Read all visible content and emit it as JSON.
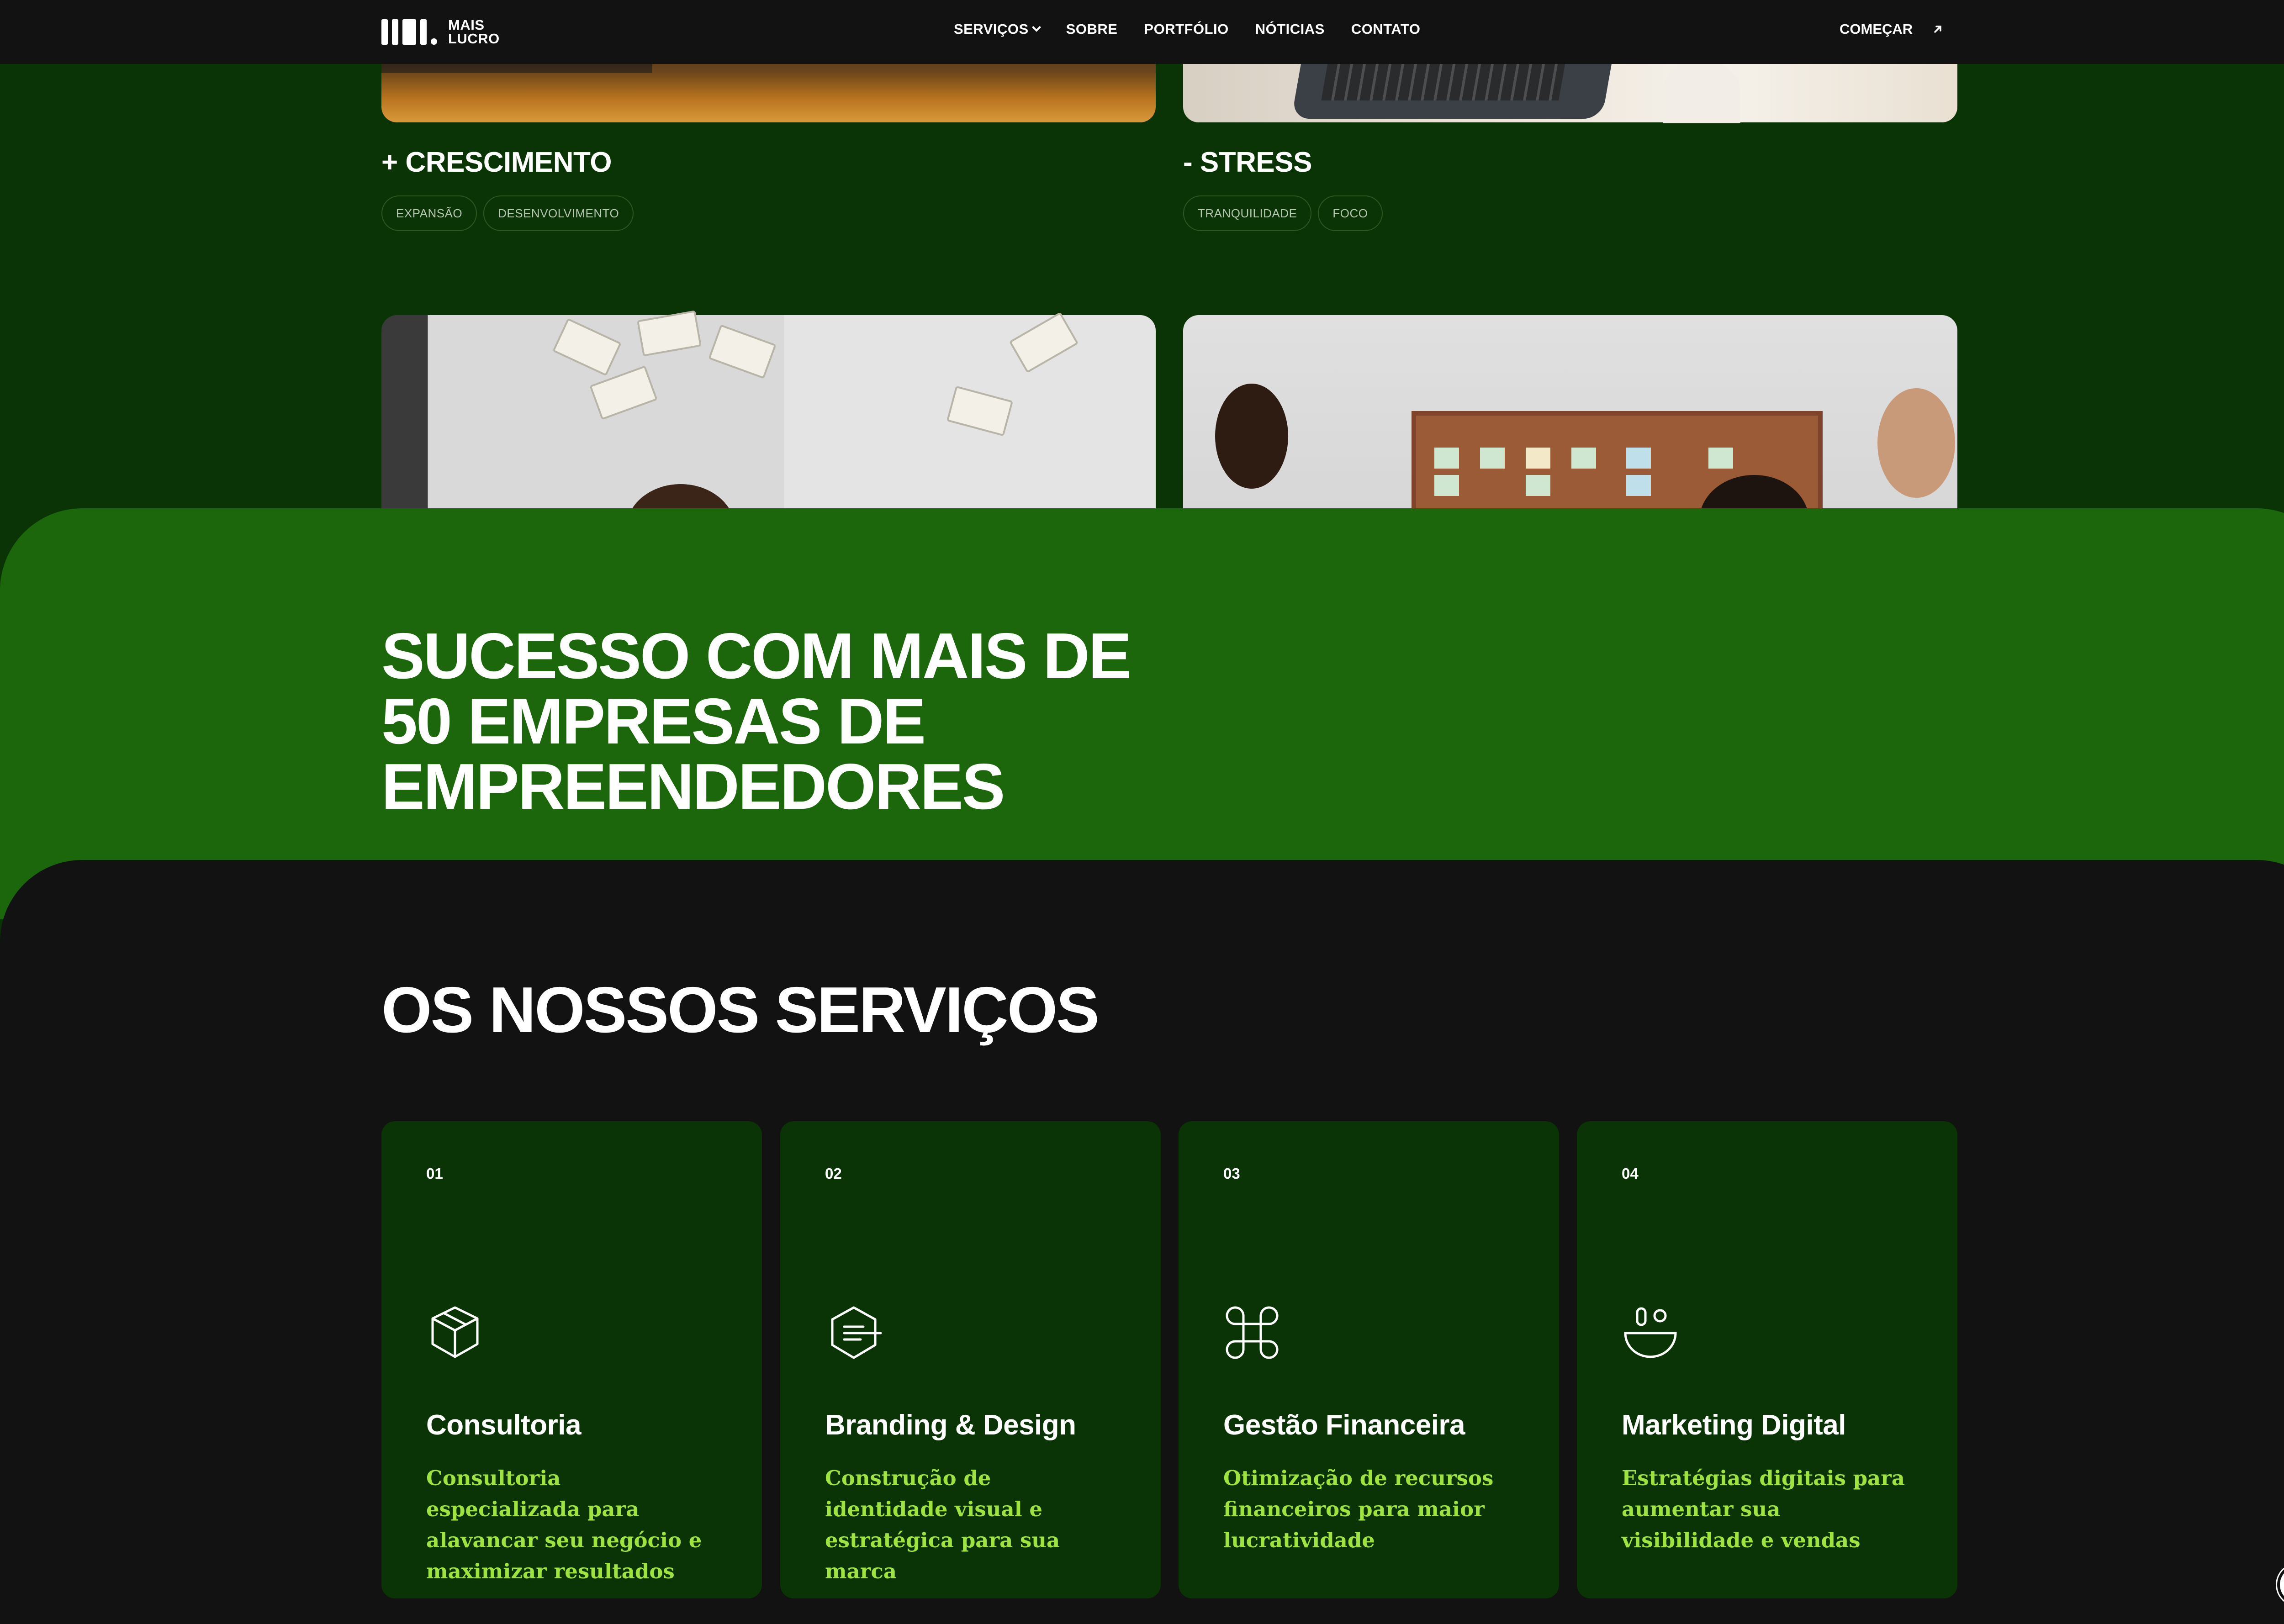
{
  "nav": {
    "logo_text_1": "MAIS",
    "logo_text_2": "LUCRO",
    "menu": [
      {
        "label": "SERVIÇOS"
      },
      {
        "label": "SOBRE"
      },
      {
        "label": "PORTFÓLIO"
      },
      {
        "label": "NÓTICIAS"
      },
      {
        "label": "CONTATO"
      }
    ],
    "cta_label": "COMEÇAR"
  },
  "benefits": [
    {
      "title": "+ CRESCIMENTO",
      "tags": [
        "EXPANSÃO",
        "DESENVOLVIMENTO"
      ]
    },
    {
      "title": "- STRESS",
      "tags": [
        "TRANQUILIDADE",
        "FOCO"
      ]
    }
  ],
  "hero": {
    "title": "SUCESSO COM MAIS DE 50 EMPRESAS DE EMPREENDEDORES"
  },
  "services": {
    "title": "OS NOSSOS SERVIÇOS",
    "items": [
      {
        "num": "01",
        "name": "Consultoria",
        "desc": "Consultoria especializada para alavancar seu negócio e maximizar resultados",
        "icon": "cube-icon"
      },
      {
        "num": "02",
        "name": "Branding & Design",
        "desc": "Construção de identidade visual e estratégica para sua marca",
        "icon": "hexagon-lines-icon"
      },
      {
        "num": "03",
        "name": "Gestão Financeira",
        "desc": "Otimização de recursos financeiros para maior lucratividade",
        "icon": "command-icon"
      },
      {
        "num": "04",
        "name": "Marketing Digital",
        "desc": "Estratégias digitais para aumentar sua visibilidade e vendas",
        "icon": "bowl-icon"
      }
    ]
  },
  "colors": {
    "nav_bg": "#121212",
    "dark_green": "#0b3406",
    "band_green": "#1c670c",
    "accent_lime": "#9ee33f"
  }
}
